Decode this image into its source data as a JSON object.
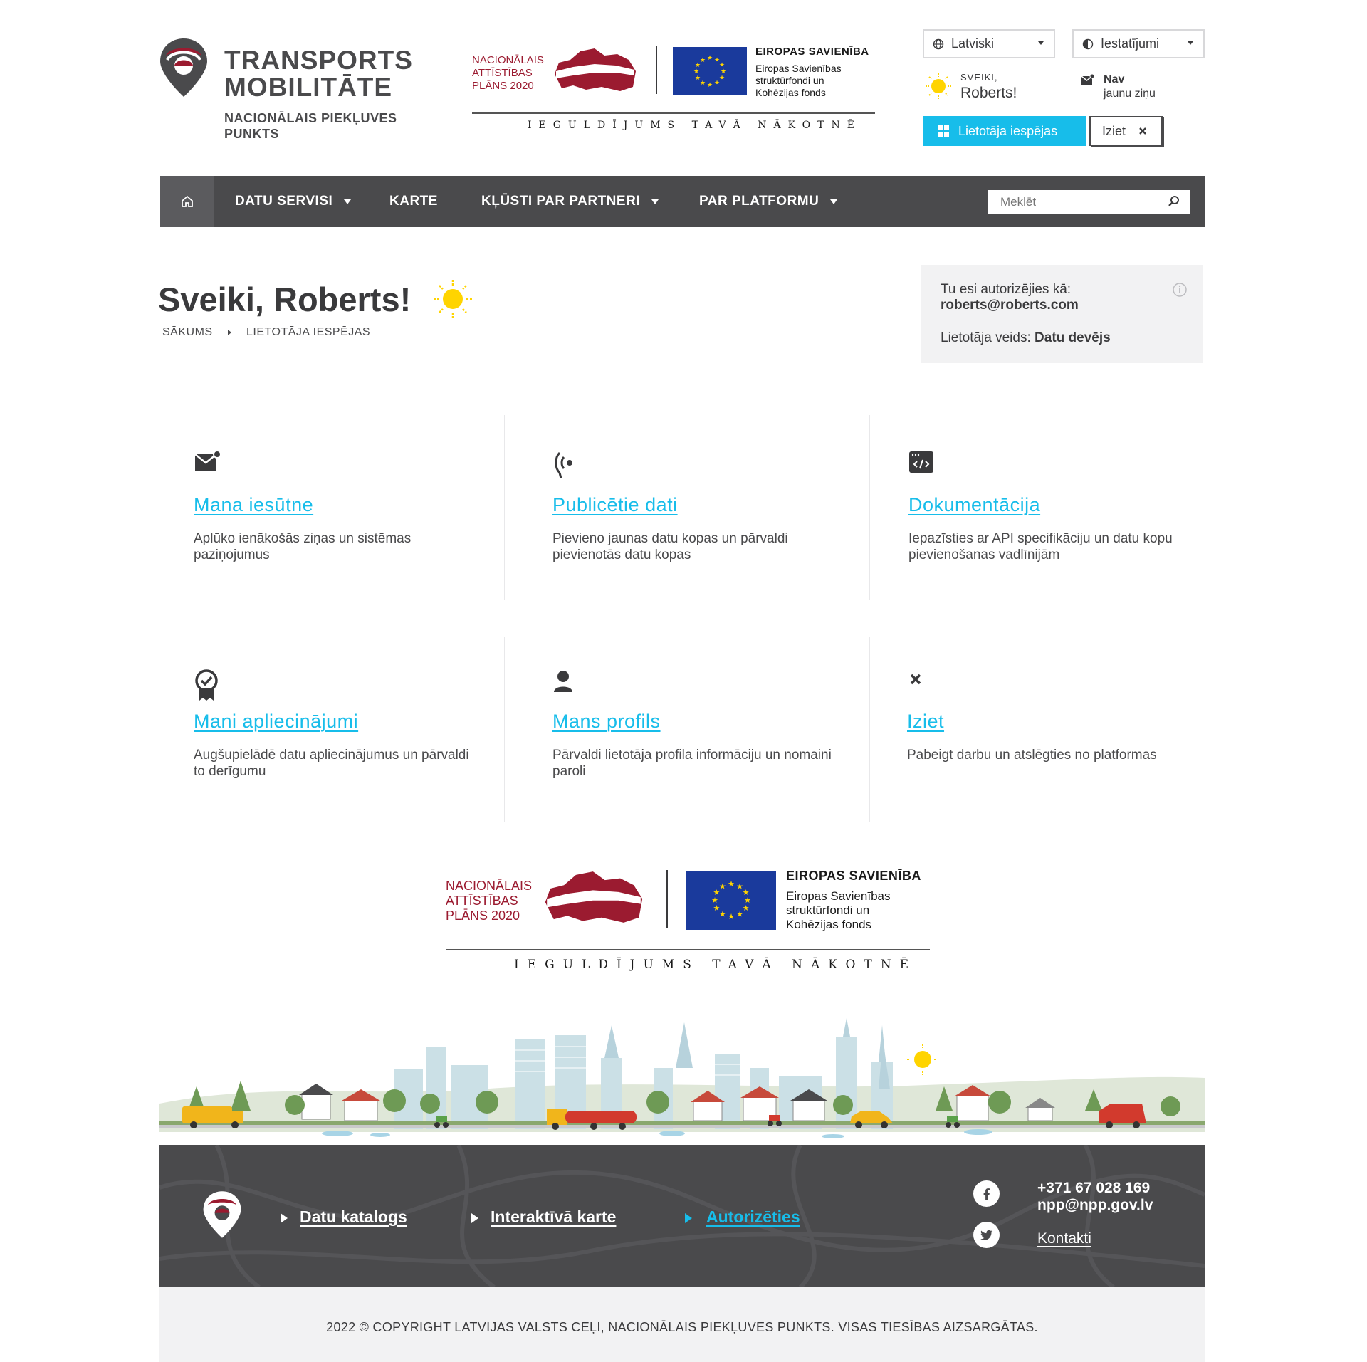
{
  "brand": {
    "title": "TRANSPORTS\nMOBILITĀTE",
    "subtitle": "NACIONĀLAIS PIEKĻUVES\nPUNKTS"
  },
  "eu_logo": {
    "nap_text": "NACIONĀLAIS\nATTĪSTĪBAS\nPLĀNS 2020",
    "eu_name": "EIROPAS SAVIENĪBA",
    "eu_desc": "Eiropas Savienības\nstruktūrfondi un\nKohēzijas fonds",
    "motto": "IEGULDĪJUMS TAVĀ NĀKOTNĒ"
  },
  "header": {
    "language": "Latviski",
    "settings": "Iestatījumi",
    "greeting_small": "SVEIKI,",
    "greeting_name": "Roberts!",
    "messages_title": "Nav",
    "messages_sub": "jaunu ziņu",
    "user_options_button": "Lietotāja iespējas",
    "logout_button": "Iziet"
  },
  "nav": {
    "items": [
      {
        "label": "DATU SERVISI",
        "has_dropdown": true
      },
      {
        "label": "KARTE",
        "has_dropdown": false
      },
      {
        "label": "KĻŪSTI PAR PARTNERI",
        "has_dropdown": true
      },
      {
        "label": "PAR PLATFORMU",
        "has_dropdown": true
      }
    ],
    "search_placeholder": "Meklēt"
  },
  "hero": {
    "title": "Sveiki, Roberts!",
    "breadcrumb": [
      "SĀKUMS",
      "LIETOTĀJA IESPĒJAS"
    ]
  },
  "auth": {
    "label": "Tu esi autorizējies kā:",
    "email": "roberts@roberts.com",
    "type_label": "Lietotāja veids:",
    "type_value": "Datu devējs"
  },
  "cards": [
    {
      "icon": "mail-icon",
      "title": "Mana iesūtne",
      "desc": "Aplūko ienākošās ziņas un sistēmas paziņojumus"
    },
    {
      "icon": "broadcast-icon",
      "title": "Publicētie dati",
      "desc": "Pievieno jaunas datu kopas un pārvaldi pievienotās datu kopas"
    },
    {
      "icon": "code-icon",
      "title": "Dokumentācija",
      "desc": "Iepazīsties ar API specifikāciju un datu kopu pievienošanas vadlīnijām"
    },
    {
      "icon": "certificate-icon",
      "title": "Mani apliecinājumi",
      "desc": "Augšupielādē datu apliecinājumus un pārvaldi to derīgumu"
    },
    {
      "icon": "user-icon",
      "title": "Mans profils",
      "desc": "Pārvaldi lietotāja profila informāciju un nomaini paroli"
    },
    {
      "icon": "close-icon",
      "title": "Iziet",
      "desc": "Pabeigt darbu un atslēgties no platformas"
    }
  ],
  "footer": {
    "links": [
      {
        "label": "Datu katalogs",
        "active": false
      },
      {
        "label": "Interaktīvā karte",
        "active": false
      },
      {
        "label": "Autorizēties",
        "active": true
      }
    ],
    "phone": "+371 67 028 169",
    "email": "npp@npp.gov.lv",
    "contacts": "Kontakti",
    "copyright": "2022 © COPYRIGHT LATVIJAS VALSTS CEĻI, NACIONĀLAIS PIEKĻUVES PUNKTS. VISAS TIESĪBAS AIZSARGĀTAS."
  },
  "colors": {
    "accent": "#17bdea",
    "nav_bg": "#4a4a4c",
    "brand_red": "#9b1b30",
    "eu_blue": "#1a3a9c",
    "sun": "#ffd400"
  }
}
